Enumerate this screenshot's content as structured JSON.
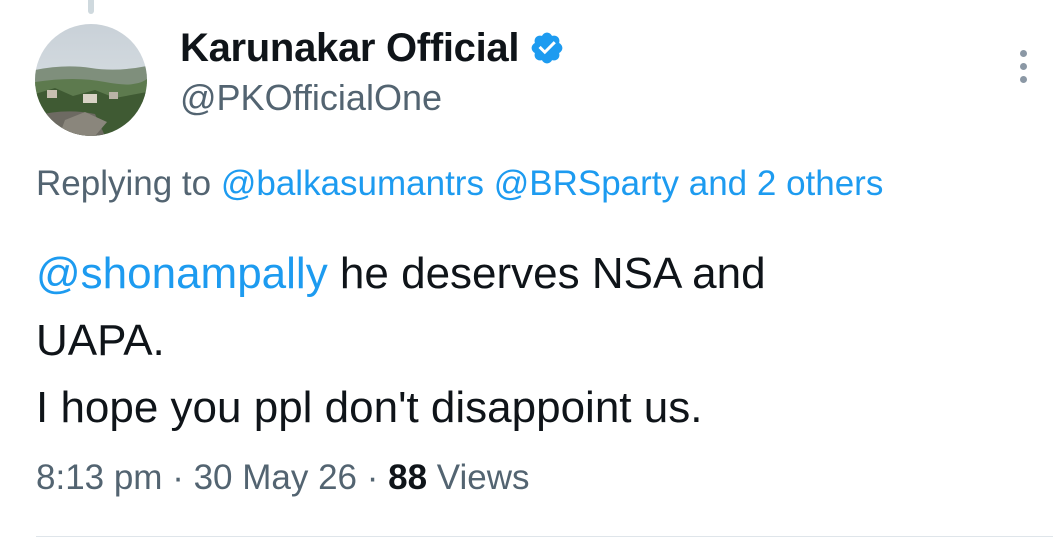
{
  "tweet": {
    "author": {
      "display_name": "Karunakar Official",
      "handle": "@PKOfficialOne",
      "verified": true,
      "verified_color": "#1d9bf0",
      "avatar_icon": "landscape-avatar"
    },
    "more_icon": "more-vertical-icon",
    "replying": {
      "prefix": "Replying to ",
      "mention_1": "@balkasumantrs",
      "mention_2": "@BRSparty",
      "and_text": " and ",
      "others": "2 others"
    },
    "body": {
      "mention": "@shonampally",
      "line_1_rest": " he deserves NSA and",
      "line_2": "UAPA.",
      "line_3": "I hope you ppl don't disappoint us."
    },
    "meta": {
      "time": "8:13 pm",
      "separator": " · ",
      "date": "30 May 26",
      "views_count": "88",
      "views_label": " Views"
    }
  },
  "colors": {
    "link": "#1d9bf0",
    "secondary_text": "#536471",
    "primary_text": "#0f1419"
  }
}
